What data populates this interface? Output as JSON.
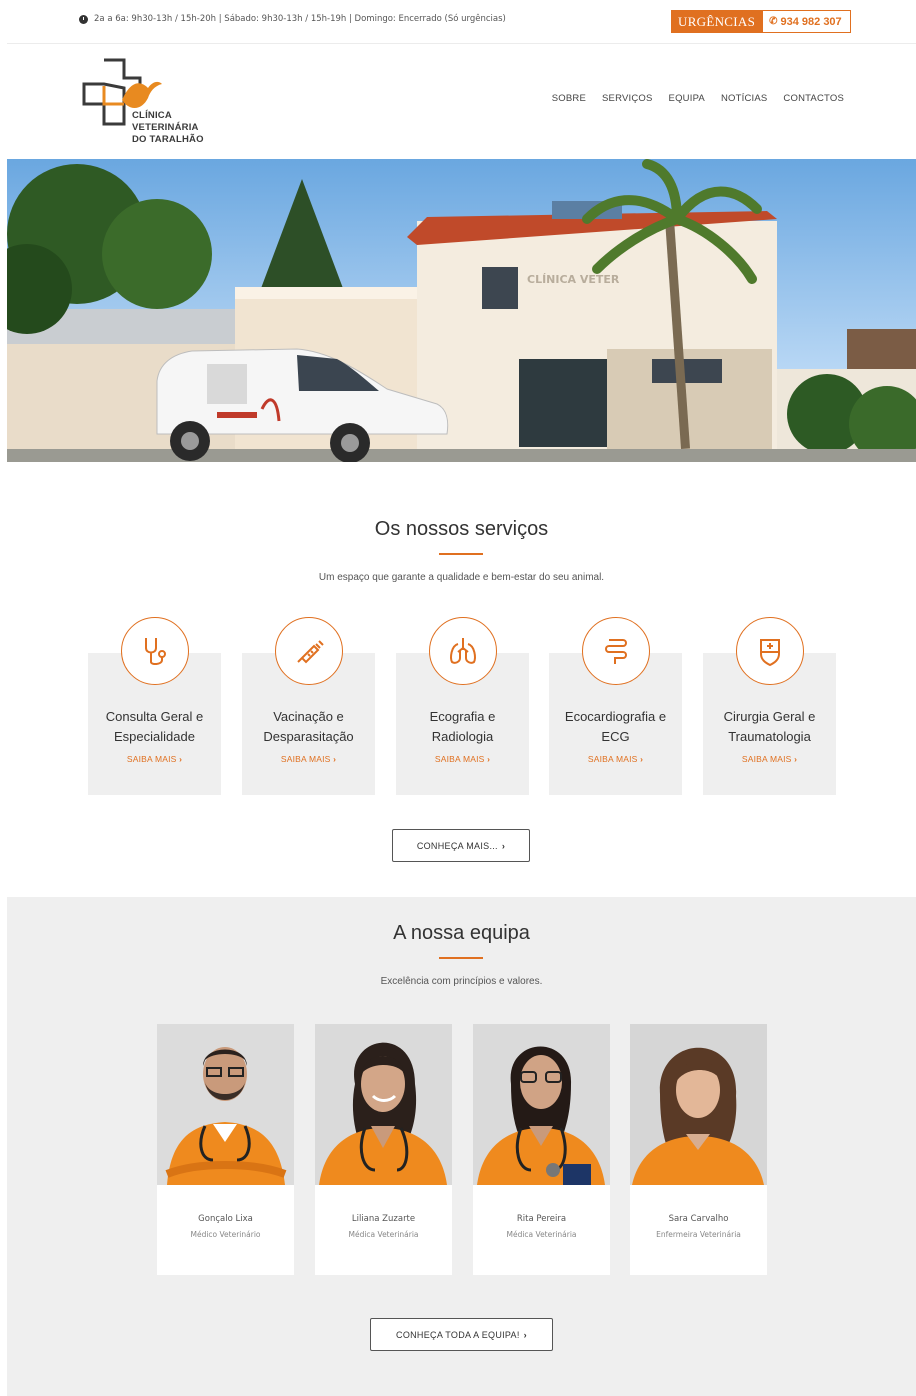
{
  "topbar": {
    "hours": "2a a 6a: 9h30-13h / 15h-20h | Sábado: 9h30-13h / 15h-19h | Domingo: Encerrado (Só urgências)",
    "urgency_label": "URGÊNCIAS",
    "urgency_phone": "934 982 307"
  },
  "logo": {
    "line1": "CLÍNICA",
    "line2": "VETERINÁRIA",
    "line3": "DO TARALHÃO"
  },
  "nav": [
    "SOBRE",
    "SERVIÇOS",
    "EQUIPA",
    "NOTÍCIAS",
    "CONTACTOS"
  ],
  "hero": {
    "building_sign": "CLÍNICA VETER"
  },
  "services": {
    "title": "Os nossos serviços",
    "subtitle": "Um espaço que garante a qualidade e bem-estar do seu animal.",
    "items": [
      {
        "line1": "Consulta Geral e",
        "line2": "Especialidade",
        "more": "SAIBA MAIS",
        "icon": "stethoscope-icon"
      },
      {
        "line1": "Vacinação e",
        "line2": "Desparasitação",
        "more": "SAIBA MAIS",
        "icon": "syringe-icon"
      },
      {
        "line1": "Ecografia e",
        "line2": "Radiologia",
        "more": "SAIBA MAIS",
        "icon": "lungs-icon"
      },
      {
        "line1": "Ecocardiografia e",
        "line2": "ECG",
        "more": "SAIBA MAIS",
        "icon": "intestine-icon"
      },
      {
        "line1": "Cirurgia Geral e",
        "line2": "Traumatologia",
        "more": "SAIBA MAIS",
        "icon": "shield-medical-icon"
      }
    ],
    "button": "CONHEÇA MAIS..."
  },
  "team": {
    "title": "A nossa equipa",
    "subtitle": "Excelência com princípios e valores.",
    "members": [
      {
        "name": "Gonçalo Lixa",
        "role": "Médico Veterinário"
      },
      {
        "name": "Liliana Zuzarte",
        "role": "Médica Veterinária"
      },
      {
        "name": "Rita Pereira",
        "role": "Médica Veterinária"
      },
      {
        "name": "Sara Carvalho",
        "role": "Enfermeira Veterinária"
      }
    ],
    "button": "CONHEÇA TODA A EQUIPA!"
  },
  "colors": {
    "accent": "#e07020",
    "card_bg": "#efefef"
  }
}
